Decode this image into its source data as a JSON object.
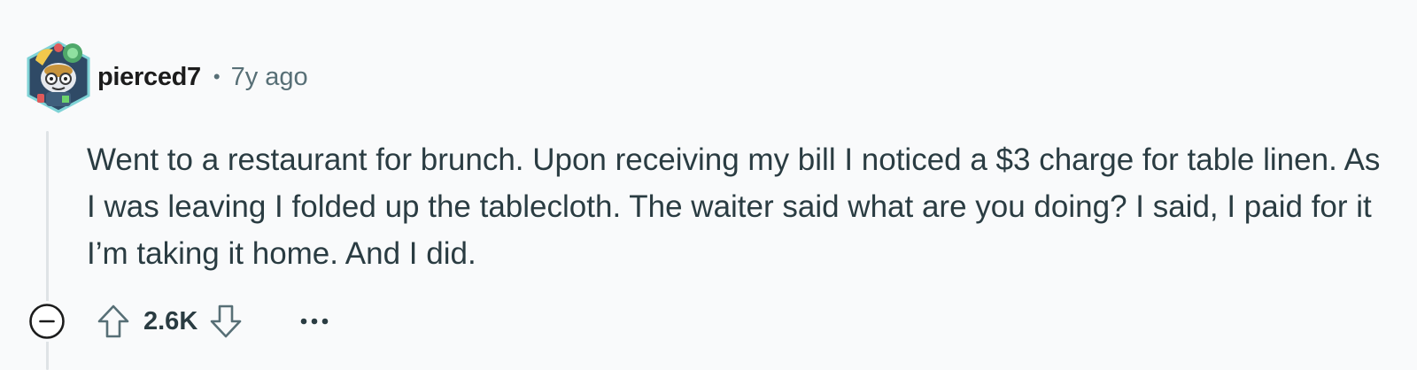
{
  "comment": {
    "author": "pierced7",
    "separator": "•",
    "time_ago": "7y ago",
    "avatar_icon": "snoo-avatar-icon",
    "body": "Went to a restaurant for brunch. Upon receiving my bill I noticed a $3 charge for table linen. As I was leaving I folded up the tablecloth. The waiter said what are you doing? I said, I paid for it I’m taking it home. And I did.",
    "score": "2.6K"
  },
  "actions": {
    "collapse_icon": "minus-circle-icon",
    "upvote_icon": "arrow-up-icon",
    "downvote_icon": "arrow-down-icon",
    "more_icon": "ellipsis-icon"
  },
  "colors": {
    "background": "#f9fafb",
    "text": "#2a3c42",
    "meta": "#576f76",
    "thread_line": "#dfe3e6"
  }
}
